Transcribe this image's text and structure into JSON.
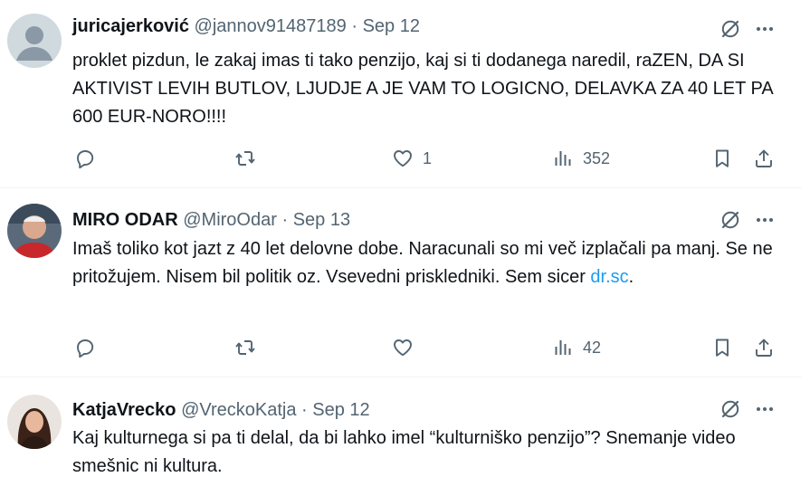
{
  "tweets": [
    {
      "name": "juricajerković",
      "handle": "@jannov91487189",
      "separator": "·",
      "date": "Sep 12",
      "text": "proklet pizdun, le zakaj imas ti tako penzijo, kaj si ti dodanega naredil, raZEN, DA SI AKTIVIST LEVIH BUTLOV, LJUDJE A JE VAM TO LOGICNO, DELAVKA ZA 40 LET PA 600 EUR-NORO!!!!",
      "likes": "1",
      "views": "352",
      "avatar": "default-avatar"
    },
    {
      "name": "MIRO ODAR",
      "handle": "@MiroOdar",
      "separator": "·",
      "date": "Sep 13",
      "text": "Imaš toliko kot jazt z 40 let delovne dobe. Naracunali so mi več izplačali pa manj. Se ne pritožujem. Nisem bil politik oz. Vsevedni priskledniki. Sem sicer ",
      "link": "dr.sc",
      "text_end": ".",
      "likes": "",
      "views": "42",
      "avatar": "photo-avatar"
    },
    {
      "name": "KatjaVrecko",
      "handle": "@VreckoKatja",
      "separator": "·",
      "date": "Sep 12",
      "text": "Kaj kulturnega si pa ti delal, da bi lahko imel “kulturniško penzijo”? Snemanje video smešnic ni kultura.",
      "avatar": "photo-avatar"
    }
  ],
  "colors": {
    "link": "#1d9bf0",
    "muted": "#536471",
    "text": "#0f1419",
    "divider": "#eff3f4"
  },
  "icons": [
    "grok-icon",
    "more-icon",
    "reply-icon",
    "retweet-icon",
    "like-icon",
    "views-icon",
    "bookmark-icon",
    "share-icon"
  ]
}
